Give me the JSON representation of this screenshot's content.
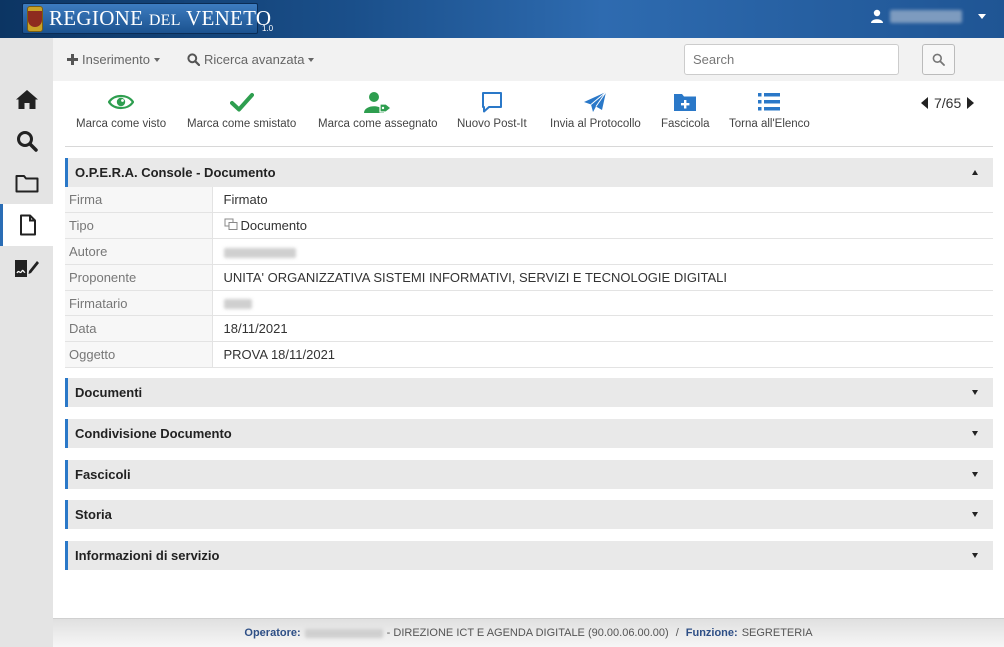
{
  "header": {
    "logo_text_1": "REGIONE ",
    "logo_text_2": "DEL",
    "logo_text_3": " VENETO",
    "version": "1.0",
    "user_icon": "user-icon",
    "username": "DI LISA DAVIDE"
  },
  "sidebar": {
    "items": [
      {
        "icon": "home-icon"
      },
      {
        "icon": "search-icon"
      },
      {
        "icon": "folder-icon"
      },
      {
        "icon": "document-icon",
        "active": true
      },
      {
        "icon": "signature-icon"
      }
    ]
  },
  "toolbar": {
    "inserimento_label": "Inserimento",
    "ricerca_label": "Ricerca avanzata",
    "search_placeholder": "Search"
  },
  "actions": [
    {
      "label": "Marca come visto",
      "icon": "eye-icon",
      "color": "#2e9e4f"
    },
    {
      "label": "Marca come smistato",
      "icon": "check-icon",
      "color": "#2e9e4f"
    },
    {
      "label": "Marca come assegnato",
      "icon": "user-tag-icon",
      "color": "#2e9e4f"
    },
    {
      "label": "Nuovo Post-It",
      "icon": "comment-icon",
      "color": "#2a78c8"
    },
    {
      "label": "Invia al Protocollo",
      "icon": "paper-plane-icon",
      "color": "#2a78c8"
    },
    {
      "label": "Fascicola",
      "icon": "folder-plus-icon",
      "color": "#2a78c8"
    },
    {
      "label": "Torna all'Elenco",
      "icon": "list-icon",
      "color": "#2a78c8"
    }
  ],
  "pager": {
    "text": "7/65"
  },
  "main_panel": {
    "title": "O.P.E.R.A. Console - Documento",
    "rows": [
      {
        "key": "Firma",
        "value": "Firmato"
      },
      {
        "key": "Tipo",
        "value": "Documento"
      },
      {
        "key": "Autore",
        "value": "Franco Laura"
      },
      {
        "key": "Proponente",
        "value": "UNITA' ORGANIZZATIVA SISTEMI INFORMATIVI, SERVIZI E TECNOLOGIE DIGITALI"
      },
      {
        "key": "Firmatario",
        "value": "laura"
      },
      {
        "key": "Data",
        "value": "18/11/2021"
      },
      {
        "key": "Oggetto",
        "value": "PROVA 18/11/2021"
      }
    ]
  },
  "collapsed_panels": [
    {
      "title": "Documenti"
    },
    {
      "title": "Condivisione Documento"
    },
    {
      "title": "Fascicoli"
    },
    {
      "title": "Storia"
    },
    {
      "title": "Informazioni di servizio"
    }
  ],
  "footer": {
    "operatore_label": "Operatore:",
    "operatore_name": "DI LISA DAVIDE",
    "department": "- DIREZIONE ICT E AGENDA DIGITALE (90.00.06.00.00)",
    "separator": "/",
    "funzione_label": "Funzione:",
    "funzione_value": "SEGRETERIA"
  },
  "colors": {
    "header_blue": "#1a4f8a",
    "accent_blue": "#2a78c8",
    "green": "#2e9e4f",
    "signed_red": "#c23a3a"
  }
}
